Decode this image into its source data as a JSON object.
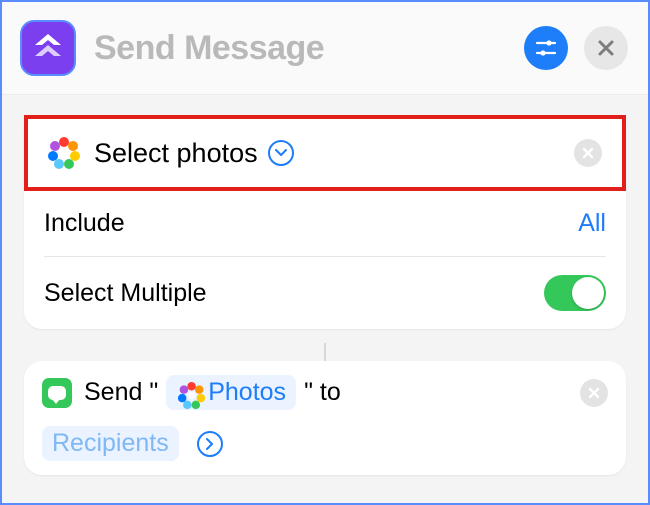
{
  "header": {
    "title": "Send Message"
  },
  "select_card": {
    "label": "Select photos",
    "include_label": "Include",
    "include_value": "All",
    "multiple_label": "Select Multiple",
    "multiple_on": true
  },
  "send_card": {
    "prefix": "Send \"",
    "photos_token": "Photos",
    "midfix": "\" to",
    "recipients_token": "Recipients"
  },
  "icons": {
    "app": "shortcuts-icon",
    "settings": "sliders-icon",
    "close": "close-icon",
    "photos": "photos-icon",
    "chevron": "chevron-down-icon",
    "clear": "clear-icon",
    "messages": "messages-icon",
    "arrow": "chevron-right-icon"
  },
  "colors": {
    "accent": "#1e7df9",
    "toggle_on": "#34c759",
    "highlight": "#e2201b"
  }
}
